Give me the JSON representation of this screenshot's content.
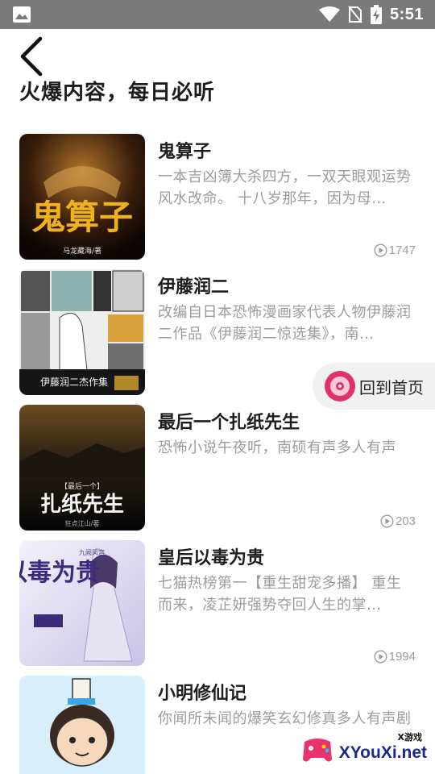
{
  "status_bar": {
    "time": "5:51",
    "icons": [
      "gallery-icon",
      "wifi-icon",
      "no-sim-icon",
      "battery-charging-icon"
    ]
  },
  "header": {
    "back_icon": "chevron-left-icon",
    "title": "火爆内容，每日必听"
  },
  "items": [
    {
      "title": "鬼算子",
      "description": "一本吉凶簿大杀四方，一双天眼观运势风水改命。 十八岁那年，因为母…",
      "plays": "1747",
      "cover_text": "鬼算子",
      "cover_author": "马龙藏海/著"
    },
    {
      "title": "伊藤润二",
      "description": "改编自日本恐怖漫画家代表人物伊藤润二作品《伊藤润二惊选集》，南…",
      "plays": "",
      "cover_text": "伊藤润二杰作集"
    },
    {
      "title": "最后一个扎纸先生",
      "description": "恐怖小说午夜听，南硕有声多人有声",
      "plays": "203",
      "cover_text": "扎纸先生",
      "cover_tag": "【最后一个】",
      "cover_author": "狂点江山/著"
    },
    {
      "title": "皇后以毒为贵",
      "description": "七猫热榜第一【重生甜宠多播】 重生而来，凌芷妍强势夺回人生的掌…",
      "plays": "1994",
      "cover_text": "以毒为贵",
      "cover_tag": "九阙凤宫"
    },
    {
      "title": "小明修仙记",
      "description": "你闻所未闻的爆笑玄幻修真多人有声剧",
      "plays": ""
    }
  ],
  "home_button": {
    "label": "回到首页",
    "icon": "disc-icon"
  },
  "watermark": {
    "small": "X游戏",
    "big": "XYouXi.net"
  },
  "colors": {
    "status_bar": "#7a7a7a",
    "title": "#1c1c1c",
    "description": "#9c9c9c",
    "home_button_bg": "#f1f1f1",
    "home_icon_pink": "#e0316b"
  }
}
